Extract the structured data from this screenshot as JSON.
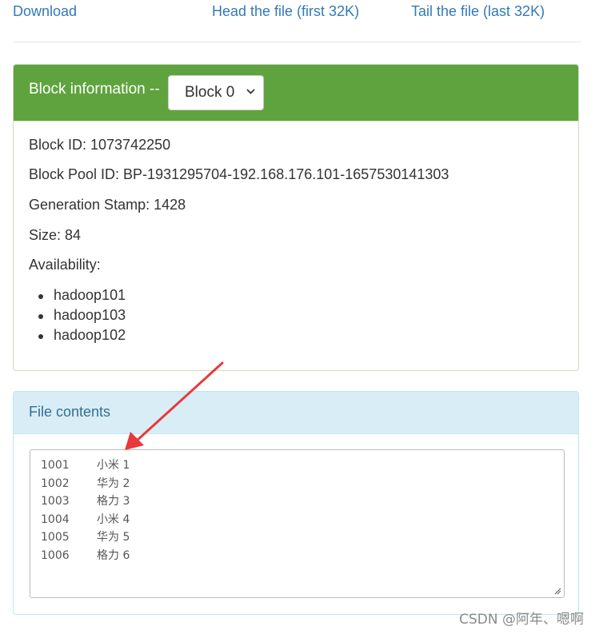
{
  "top_links": {
    "download": "Download",
    "head": "Head the file (first 32K)",
    "tail": "Tail the file (last 32K)"
  },
  "block_panel": {
    "title": "Block information --",
    "select_value": "Block 0",
    "block_id": "Block ID: 1073742250",
    "pool_id": "Block Pool ID: BP-1931295704-192.168.176.101-1657530141303",
    "generation_stamp": "Generation Stamp: 1428",
    "size": "Size: 84",
    "availability_label": "Availability:",
    "availability": [
      "hadoop101",
      "hadoop103",
      "hadoop102"
    ]
  },
  "contents_panel": {
    "title": "File contents",
    "lines": [
      {
        "id": "1001",
        "rest": "小米 1"
      },
      {
        "id": "1002",
        "rest": "华为 2"
      },
      {
        "id": "1003",
        "rest": "格力 3"
      },
      {
        "id": "1004",
        "rest": "小米 4"
      },
      {
        "id": "1005",
        "rest": "华为 5"
      },
      {
        "id": "1006",
        "rest": "格力 6"
      }
    ]
  },
  "colors": {
    "link": "#337ab7",
    "success_heading": "#5fa33e",
    "info_heading": "#d9edf7",
    "info_text": "#31708f",
    "arrow": "#e8393c"
  },
  "watermark": "CSDN @阿年、嗯啊"
}
